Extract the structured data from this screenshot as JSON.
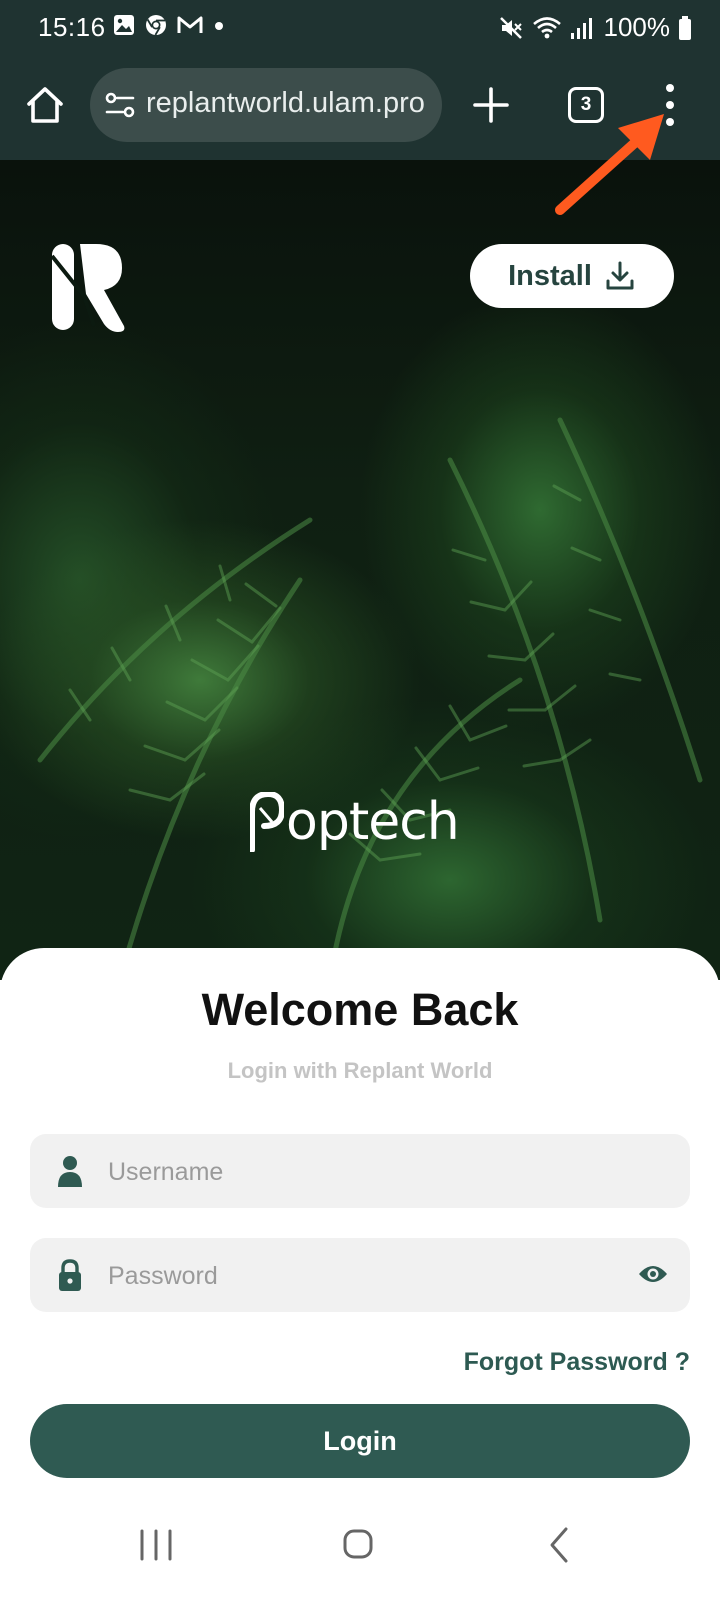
{
  "status_bar": {
    "time": "15:16",
    "notification_icons": [
      "gallery-icon",
      "chrome-icon",
      "gmail-icon",
      "dot-icon"
    ],
    "system_icons": [
      "mute-icon",
      "wifi-icon",
      "signal-icon",
      "battery-icon"
    ],
    "battery_percent": "100%"
  },
  "browser": {
    "url": "replantworld.ulam.pro",
    "tab_count": "3",
    "colors": {
      "toolbar": "#1f3331",
      "address_bar": "#3c4d4b"
    }
  },
  "hero": {
    "install_label": "Install",
    "partner_logo_text": "optech"
  },
  "login": {
    "title": "Welcome Back",
    "subtitle": "Login with Replant World",
    "username_placeholder": "Username",
    "password_placeholder": "Password",
    "forgot_password": "Forgot Password ?",
    "login_button": "Login",
    "colors": {
      "accent": "#2f5a52",
      "field_bg": "#f1f1f1"
    }
  },
  "annotation": {
    "color": "#ff5a1f",
    "points_to": "browser-menu-button"
  },
  "nav_bar": {
    "buttons": [
      "recents-icon",
      "home-icon",
      "back-icon"
    ]
  }
}
